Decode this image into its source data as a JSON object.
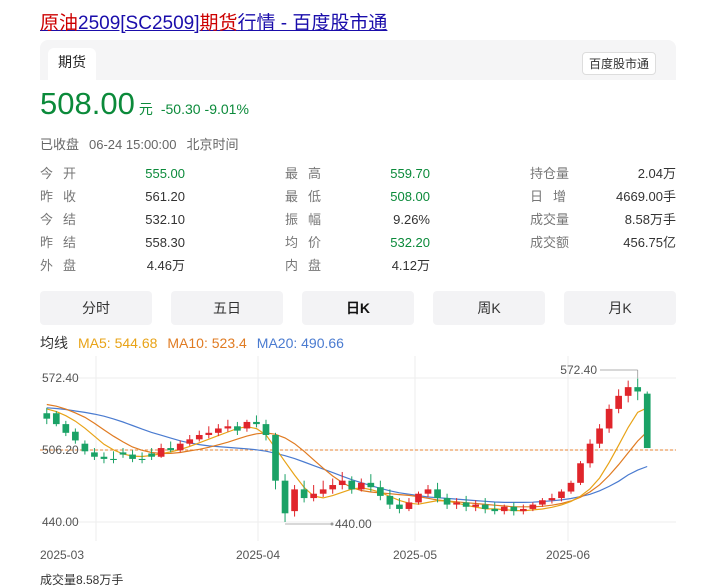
{
  "page": {
    "title_part1": "原油",
    "title_part2": "2509[SC2509]",
    "title_part3": "期货",
    "title_part4": "行情 - 百度股市通"
  },
  "tabbar": {
    "active_tab": "期货",
    "brand_button": "百度股市通"
  },
  "quote": {
    "price": "508.00",
    "unit": "元",
    "change": "-50.30",
    "change_pct": "-9.01%",
    "status": "已收盘",
    "time": "06-24 15:00:00",
    "timezone": "北京时间"
  },
  "stats": [
    {
      "label": "今开",
      "value": "555.00",
      "color": "#0b8a3a"
    },
    {
      "label": "昨收",
      "value": "561.20",
      "color": "#333333"
    },
    {
      "label": "今结",
      "value": "532.10",
      "color": "#333333"
    },
    {
      "label": "昨结",
      "value": "558.30",
      "color": "#333333"
    },
    {
      "label": "外盘",
      "value": "4.46万",
      "color": "#333333"
    },
    {
      "label": "最高",
      "value": "559.70",
      "color": "#0b8a3a"
    },
    {
      "label": "最低",
      "value": "508.00",
      "color": "#0b8a3a"
    },
    {
      "label": "振幅",
      "value": "9.26%",
      "color": "#333333"
    },
    {
      "label": "均价",
      "value": "532.20",
      "color": "#0b8a3a"
    },
    {
      "label": "内盘",
      "value": "4.12万",
      "color": "#333333"
    },
    {
      "label": "持仓量",
      "value": "2.04万",
      "color": "#333333"
    },
    {
      "label": "日增",
      "value": "4669.00手",
      "color": "#333333"
    },
    {
      "label": "成交量",
      "value": "8.58万手",
      "color": "#333333"
    },
    {
      "label": "成交额",
      "value": "456.75亿",
      "color": "#333333"
    }
  ],
  "chart_tabs": [
    "分时",
    "五日",
    "日K",
    "周K",
    "月K"
  ],
  "active_chart_tab": "日K",
  "ma": {
    "label": "均线",
    "ma5": "MA5: 544.68",
    "ma10": "MA10: 523.4",
    "ma20": "MA20: 490.66",
    "ma5_color": "#e8a317",
    "ma10_color": "#e07b22",
    "ma20_color": "#4a7bd0"
  },
  "chart_data": {
    "type": "candlestick",
    "y_ticks": [
      "572.40",
      "506.20",
      "440.00"
    ],
    "x_ticks": [
      "2025-03",
      "2025-04",
      "2025-05",
      "2025-06"
    ],
    "max_label": "572.40",
    "min_label": "440.00",
    "ylim": [
      440.0,
      572.4
    ],
    "last_close_line": 506.2,
    "up_color": "#e0252b",
    "down_color": "#1aa266",
    "candles": [
      [
        540,
        545,
        535,
        530
      ],
      [
        540,
        542,
        530,
        528
      ],
      [
        530,
        533,
        522,
        519
      ],
      [
        523,
        526,
        515,
        512
      ],
      [
        512,
        515,
        505,
        502
      ],
      [
        504,
        508,
        500,
        497
      ],
      [
        500,
        504,
        498,
        494
      ],
      [
        498,
        505,
        497,
        494
      ],
      [
        504,
        508,
        502,
        499
      ],
      [
        502,
        506,
        498,
        495
      ],
      [
        498,
        504,
        497,
        494
      ],
      [
        503,
        508,
        500,
        497
      ],
      [
        500,
        512,
        508,
        499
      ],
      [
        508,
        514,
        506,
        504
      ],
      [
        506,
        515,
        512,
        504
      ],
      [
        512,
        520,
        516,
        510
      ],
      [
        516,
        524,
        520,
        514
      ],
      [
        520,
        528,
        522,
        517
      ],
      [
        522,
        530,
        526,
        519
      ],
      [
        526,
        534,
        528,
        523
      ],
      [
        528,
        532,
        524,
        520
      ],
      [
        526,
        534,
        532,
        523
      ],
      [
        532,
        538,
        530,
        527
      ],
      [
        530,
        534,
        520,
        515
      ],
      [
        520,
        522,
        478,
        470
      ],
      [
        478,
        484,
        448,
        440
      ],
      [
        450,
        474,
        470,
        445
      ],
      [
        470,
        478,
        462,
        458
      ],
      [
        462,
        474,
        466,
        459
      ],
      [
        466,
        478,
        470,
        463
      ],
      [
        470,
        480,
        474,
        466
      ],
      [
        474,
        486,
        478,
        470
      ],
      [
        478,
        482,
        470,
        466
      ],
      [
        470,
        480,
        476,
        468
      ],
      [
        476,
        484,
        472,
        468
      ],
      [
        472,
        478,
        464,
        460
      ],
      [
        464,
        470,
        456,
        452
      ],
      [
        456,
        462,
        452,
        448
      ],
      [
        452,
        462,
        458,
        450
      ],
      [
        458,
        468,
        466,
        456
      ],
      [
        466,
        474,
        470,
        463
      ],
      [
        470,
        476,
        462,
        458
      ],
      [
        462,
        466,
        456,
        452
      ],
      [
        456,
        462,
        458,
        452
      ],
      [
        458,
        464,
        454,
        450
      ],
      [
        454,
        460,
        456,
        450
      ],
      [
        456,
        462,
        452,
        448
      ],
      [
        452,
        458,
        450,
        447
      ],
      [
        450,
        456,
        454,
        447
      ],
      [
        454,
        458,
        450,
        446
      ],
      [
        450,
        456,
        452,
        447
      ],
      [
        452,
        458,
        456,
        450
      ],
      [
        456,
        462,
        460,
        454
      ],
      [
        460,
        466,
        462,
        457
      ],
      [
        462,
        470,
        468,
        459
      ],
      [
        468,
        478,
        476,
        466
      ],
      [
        476,
        496,
        494,
        474
      ],
      [
        494,
        516,
        512,
        490
      ],
      [
        512,
        530,
        526,
        508
      ],
      [
        526,
        548,
        544,
        522
      ],
      [
        544,
        562,
        556,
        540
      ],
      [
        556,
        570,
        564,
        550
      ],
      [
        564,
        572,
        560,
        552
      ],
      [
        558,
        560,
        508,
        508
      ]
    ],
    "ma5": [
      544,
      541,
      536,
      529,
      520,
      511,
      505,
      501,
      500,
      501,
      503,
      505,
      508,
      512,
      516,
      520,
      524,
      528,
      527,
      520,
      505,
      490,
      475,
      464,
      462,
      465,
      469,
      472,
      470,
      467,
      462,
      458,
      456,
      458,
      460,
      459,
      456,
      454,
      452,
      452,
      451,
      450,
      451,
      452,
      454,
      457,
      462,
      470,
      482,
      500,
      520,
      540,
      545
    ],
    "ma10": [
      548,
      546,
      542,
      537,
      530,
      522,
      515,
      509,
      505,
      503,
      503,
      504,
      506,
      508,
      511,
      514,
      518,
      521,
      522,
      520,
      514,
      505,
      495,
      485,
      477,
      471,
      468,
      467,
      466,
      465,
      464,
      462,
      460,
      459,
      458,
      457,
      456,
      455,
      454,
      454,
      454,
      455,
      457,
      460,
      465,
      473,
      484,
      497,
      512,
      523
    ],
    "ma20": [
      545,
      544,
      542,
      540,
      537,
      533,
      528,
      523,
      519,
      515,
      512,
      510,
      509,
      508,
      507,
      505,
      502,
      498,
      493,
      488,
      483,
      478,
      474,
      470,
      467,
      465,
      463,
      462,
      461,
      460,
      459,
      458,
      458,
      458,
      459,
      460,
      462,
      465,
      470,
      477,
      486,
      491
    ]
  },
  "volume_label": "成交量8.58万手"
}
